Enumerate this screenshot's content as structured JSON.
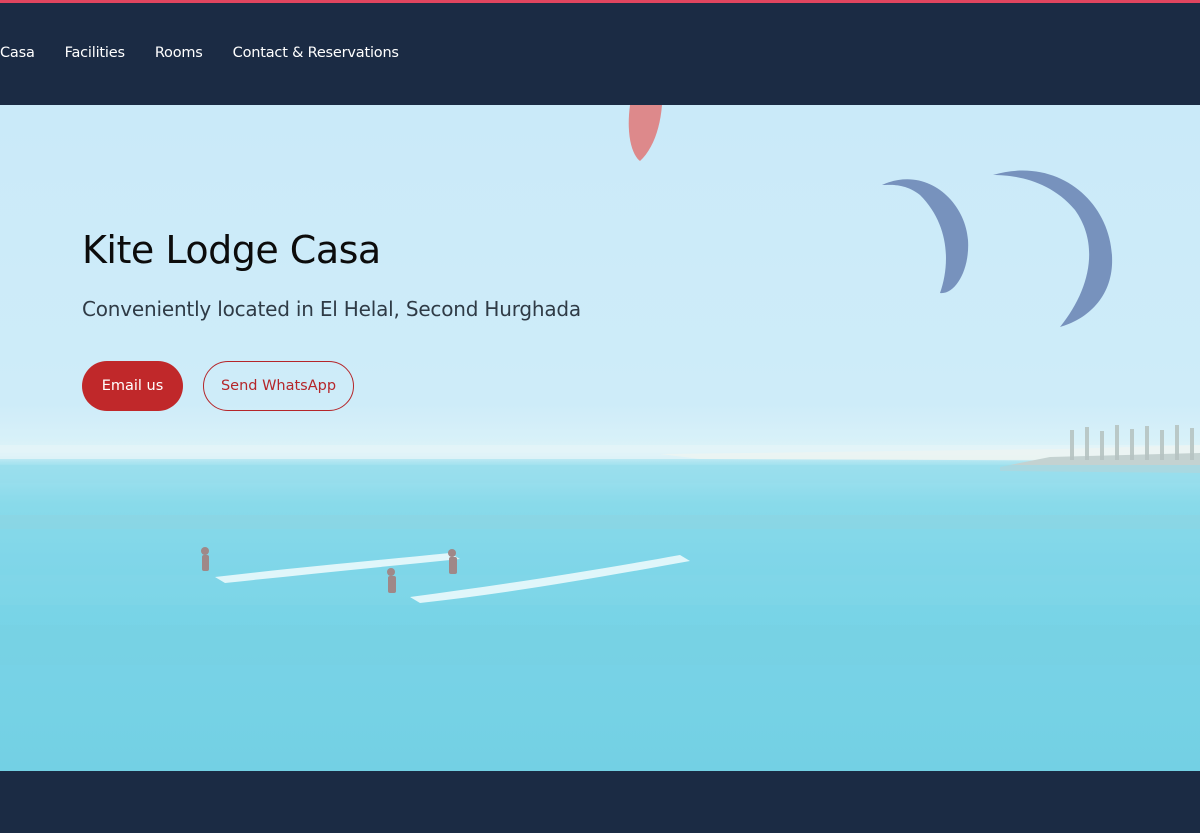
{
  "nav": {
    "items": [
      {
        "label": "Casa"
      },
      {
        "label": "Facilities"
      },
      {
        "label": "Rooms"
      },
      {
        "label": "Contact & Reservations"
      }
    ]
  },
  "hero": {
    "title": "Kite Lodge Casa",
    "subtitle": "Conveniently located in El Helal, Second Hurghada",
    "buttons": {
      "email_label": "Email us",
      "whatsapp_label": "Send WhatsApp"
    }
  },
  "colors": {
    "navbar": "#1b2b44",
    "accent_line": "#e0455f",
    "primary_button": "#c0282a",
    "outline_button": "#b5262a"
  }
}
